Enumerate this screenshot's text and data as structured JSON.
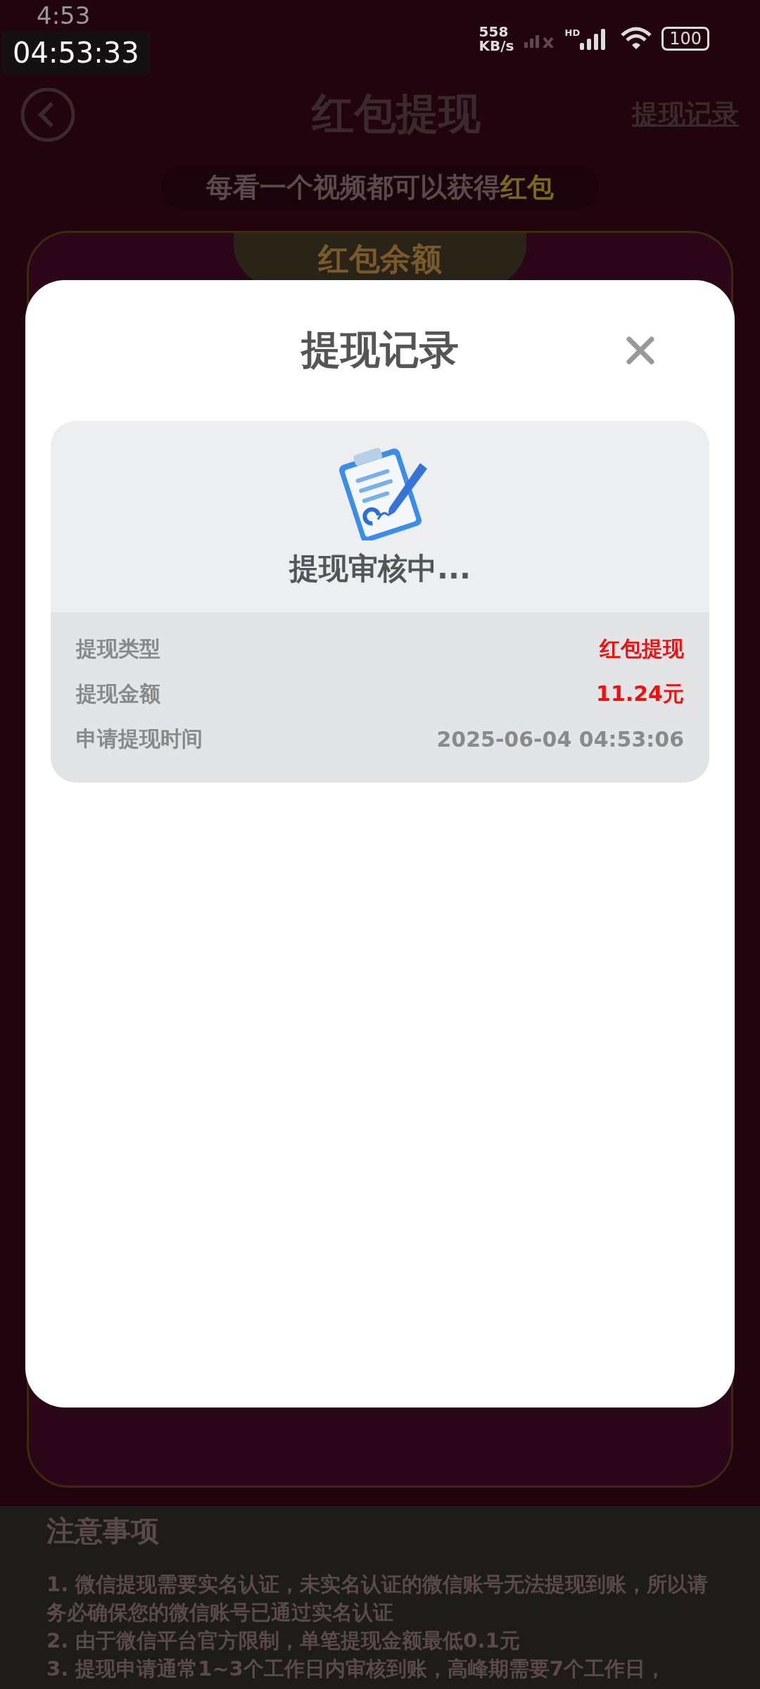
{
  "status_bar": {
    "time": "4:53",
    "recorder_time": "04:53:33",
    "speed_value": "558",
    "speed_unit": "KB/s",
    "hd_label": "HD",
    "battery": "100"
  },
  "header": {
    "title": "红包提现",
    "link": "提现记录"
  },
  "banner": {
    "parts": [
      {
        "text": "每看一个视频都可以获得",
        "highlight": false
      },
      {
        "text": "红包",
        "highlight": true
      }
    ]
  },
  "balance_card": {
    "title": "红包余额"
  },
  "notes": {
    "title": "注意事项",
    "lines": [
      "1. 微信提现需要实名认证，未实名认证的微信账号无法提现到账，所以请务必确保您的微信账号已通过实名认证",
      "2. 由于微信平台官方限制，单笔提现金额最低0.1元",
      "3. 提现申请通常1~3个工作日内审核到账，高峰期需要7个工作日，"
    ]
  },
  "dialog": {
    "title": "提现记录",
    "status": "提现审核中...",
    "rows": [
      {
        "label": "提现类型",
        "value": "红包提现",
        "highlight": true
      },
      {
        "label": "提现金额",
        "value": "11.24元",
        "highlight": true
      },
      {
        "label": "申请提现时间",
        "value": "2025-06-04 04:53:06",
        "highlight": false
      }
    ]
  }
}
